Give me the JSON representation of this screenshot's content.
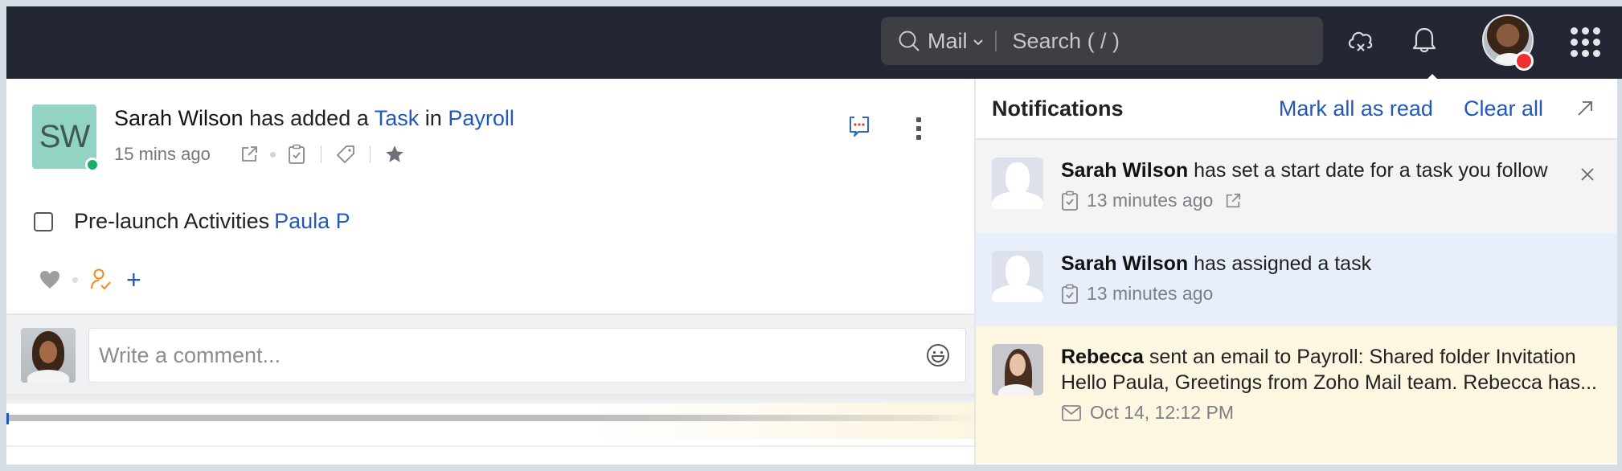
{
  "topbar": {
    "search": {
      "scope_label": "Mail",
      "placeholder": "Search ( / )"
    },
    "icons": [
      "search-icon",
      "chevron-down-icon",
      "cloud-offline-icon",
      "bell-icon",
      "user-avatar",
      "apps-grid-icon"
    ],
    "user_status_color": "#f0302f"
  },
  "feed": {
    "author_initials": "SW",
    "author_name": "Sarah Wilson",
    "action_text": "has added a",
    "object_link": "Task",
    "in_text": "in",
    "group_link": "Payroll",
    "timestamp": "15 mins ago",
    "author_status_color": "#14b066",
    "task": {
      "title": "Pre-launch Activities",
      "assignee": "Paula P",
      "completed": false
    },
    "add_label": "+",
    "comment": {
      "placeholder": "Write a comment..."
    }
  },
  "notifications": {
    "title": "Notifications",
    "mark_all_read": "Mark all as read",
    "clear_all": "Clear all",
    "items": [
      {
        "actor": "Sarah Wilson",
        "text": "has set a start date for a task you follow",
        "time": "13 minutes ago",
        "type": "task",
        "state": "read",
        "bg": "#f4f4f5"
      },
      {
        "actor": "Sarah Wilson",
        "text": "has assigned a task",
        "time": "13 minutes ago",
        "type": "task",
        "state": "unread",
        "bg": "#e8effb"
      },
      {
        "actor": "Rebecca",
        "text": "sent an email to Payroll: Shared folder Invitation Hello Paula, Greetings from Zoho Mail team. Rebecca has...",
        "time": "Oct 14, 12:12 PM",
        "type": "email",
        "state": "highlighted",
        "bg": "#fdf6e1"
      }
    ]
  },
  "colors": {
    "topbar_bg": "#232733",
    "link_blue": "#2358b8",
    "accent_orange": "#f08a1c"
  }
}
